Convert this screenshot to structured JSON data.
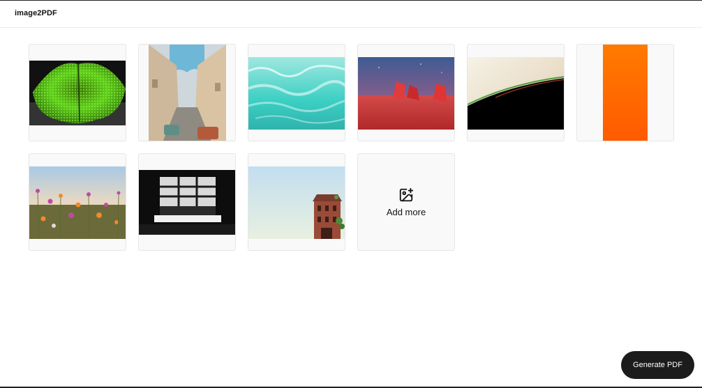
{
  "header": {
    "title": "image2PDF"
  },
  "gallery": {
    "images": [
      {
        "name": "green-leaf"
      },
      {
        "name": "city-street"
      },
      {
        "name": "turquoise-water"
      },
      {
        "name": "red-rocks-desert"
      },
      {
        "name": "abstract-wave"
      },
      {
        "name": "orange-gradient"
      },
      {
        "name": "wildflower-meadow"
      },
      {
        "name": "bw-window-interior"
      },
      {
        "name": "brick-tower-sky"
      }
    ],
    "add_more_label": "Add more",
    "add_more_icon": "image-plus-icon"
  },
  "actions": {
    "generate_label": "Generate PDF"
  },
  "colors": {
    "accent_button": "#1c1c1c",
    "tile_bg": "#f9f9f9",
    "tile_border": "#e6e6e6"
  }
}
